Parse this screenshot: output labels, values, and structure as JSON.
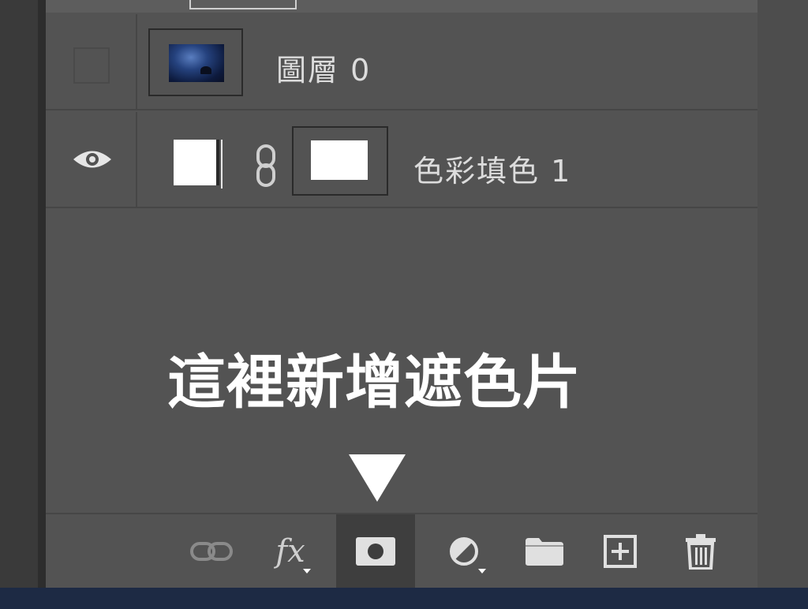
{
  "layers": [
    {
      "name": "圖層 0",
      "visible": false,
      "type": "image"
    },
    {
      "name": "色彩填色 1",
      "visible": true,
      "type": "color-fill",
      "linked_mask": true
    }
  ],
  "annotation": {
    "text": "這裡新增遮色片"
  },
  "toolbar": {
    "buttons": [
      {
        "icon": "link-icon",
        "label": ""
      },
      {
        "icon": "fx-icon",
        "label": "fx"
      },
      {
        "icon": "add-mask-icon",
        "label": "",
        "active": true
      },
      {
        "icon": "adjustment-layer-icon",
        "label": ""
      },
      {
        "icon": "folder-icon",
        "label": ""
      },
      {
        "icon": "new-layer-icon",
        "label": ""
      },
      {
        "icon": "trash-icon",
        "label": ""
      }
    ]
  },
  "colors": {
    "panel": "#535353",
    "text": "#dcdcdc",
    "annotation": "#ffffff",
    "icon": "#cfcfcf"
  }
}
